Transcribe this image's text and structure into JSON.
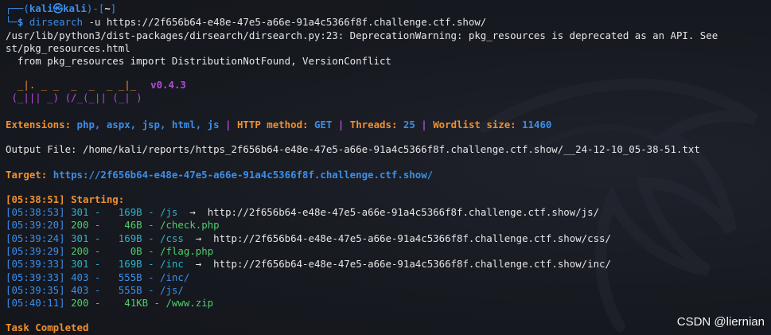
{
  "prompt": {
    "line1_prefix": "┌──(",
    "user": "kali㉿kali",
    "line1_mid": ")-[",
    "dir": "~",
    "line1_end": "]",
    "line2_prefix": "└─",
    "dollar": "$",
    "command": "dirsearch",
    "args": " -u https://2f656b64-e48e-47e5-a66e-91a4c5366f8f.challenge.ctf.show/"
  },
  "warning": {
    "line1": "/usr/lib/python3/dist-packages/dirsearch/dirsearch.py:23: DeprecationWarning: pkg_resources is deprecated as an API. See",
    "line2": "st/pkg_resources.html",
    "line3": "  from pkg_resources import DistributionNotFound, VersionConflict"
  },
  "banner": {
    "art1": "  _|. _ _  _  _  _ _|_",
    "art2": " (_||| _) (/_(_|| (_| )",
    "version": "v0.4.3"
  },
  "config": {
    "ext_label": "Extensions: ",
    "ext_value": "php, aspx, jsp, html, js",
    "sep": " | ",
    "method_label": "HTTP method: ",
    "method_value": "GET",
    "threads_label": "Threads: ",
    "threads_value": "25",
    "wordlist_label": "Wordlist size: ",
    "wordlist_value": "11460"
  },
  "output_file": "Output File: /home/kali/reports/https_2f656b64-e48e-47e5-a66e-91a4c5366f8f.challenge.ctf.show/__24-12-10_05-38-51.txt",
  "target": {
    "label": "Target: ",
    "url": "https://2f656b64-e48e-47e5-a66e-91a4c5366f8f.challenge.ctf.show/"
  },
  "starting": {
    "time": "[05:38:51]",
    "label": " Starting:"
  },
  "results": [
    {
      "time": "[05:38:53]",
      "status": "301",
      "size": "  169B",
      "path": "/js",
      "redirect": "  →  http://2f656b64-e48e-47e5-a66e-91a4c5366f8f.challenge.ctf.show/js/"
    },
    {
      "time": "[05:39:20]",
      "status": "200",
      "size": "   46B",
      "path": "/check.php",
      "redirect": ""
    },
    {
      "time": "[05:39:24]",
      "status": "301",
      "size": "  169B",
      "path": "/css",
      "redirect": "  →  http://2f656b64-e48e-47e5-a66e-91a4c5366f8f.challenge.ctf.show/css/"
    },
    {
      "time": "[05:39:29]",
      "status": "200",
      "size": "    0B",
      "path": "/flag.php",
      "redirect": ""
    },
    {
      "time": "[05:39:33]",
      "status": "301",
      "size": "  169B",
      "path": "/inc",
      "redirect": "  →  http://2f656b64-e48e-47e5-a66e-91a4c5366f8f.challenge.ctf.show/inc/"
    },
    {
      "time": "[05:39:33]",
      "status": "403",
      "size": "  555B",
      "path": "/inc/",
      "redirect": ""
    },
    {
      "time": "[05:39:35]",
      "status": "403",
      "size": "  555B",
      "path": "/js/",
      "redirect": ""
    },
    {
      "time": "[05:40:11]",
      "status": "200",
      "size": "   41KB",
      "path": "/www.zip",
      "redirect": ""
    }
  ],
  "task_completed": "Task Completed",
  "watermark": "CSDN @liernian",
  "colors": {
    "prompt": "#3b8eea",
    "orange": "#f0902e",
    "purple": "#b04cd8",
    "background": "#1a1c24"
  }
}
